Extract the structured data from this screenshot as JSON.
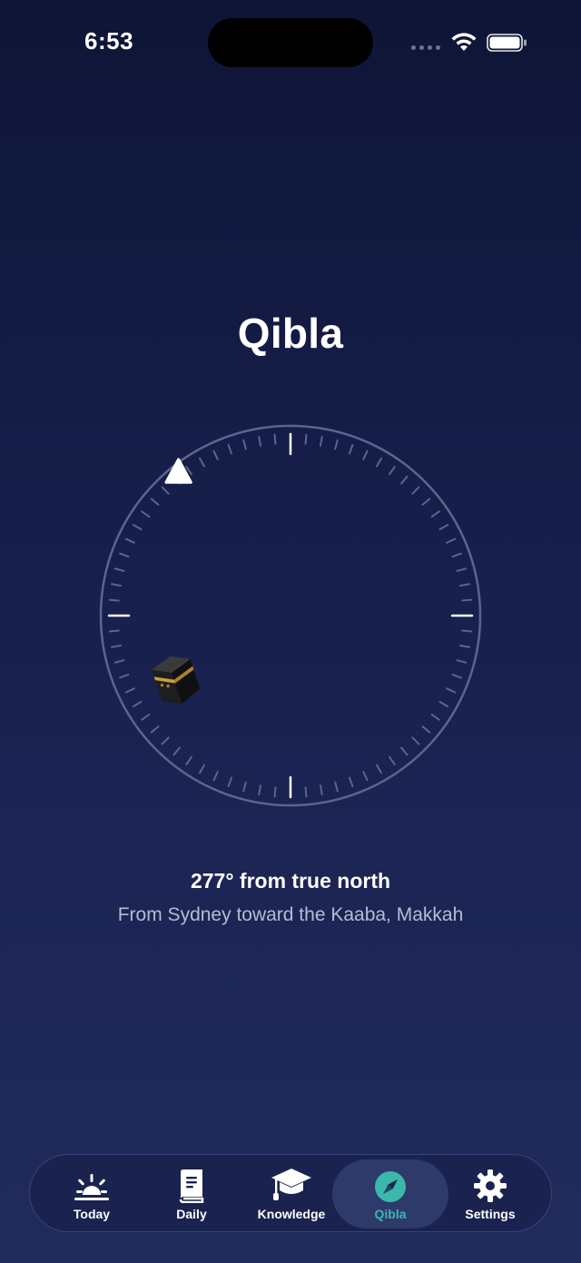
{
  "status_bar": {
    "time": "6:53"
  },
  "page": {
    "title": "Qibla"
  },
  "compass": {
    "bearing_degrees": 277,
    "kaaba_icon": "kaaba-icon",
    "pointer_icon": "triangle-pointer-icon"
  },
  "bearing": {
    "headline": "277° from true north",
    "subtitle": "From Sydney toward the Kaaba, Makkah"
  },
  "tabs": [
    {
      "label": "Today",
      "icon": "sunrise-icon",
      "active": false
    },
    {
      "label": "Daily",
      "icon": "book-icon",
      "active": false
    },
    {
      "label": "Knowledge",
      "icon": "graduation-cap-icon",
      "active": false
    },
    {
      "label": "Qibla",
      "icon": "compass-icon",
      "active": true
    },
    {
      "label": "Settings",
      "icon": "gear-icon",
      "active": false
    }
  ],
  "colors": {
    "accent": "#3bb8ac",
    "background_top": "#0e1536",
    "background_bottom": "#212c5c"
  }
}
